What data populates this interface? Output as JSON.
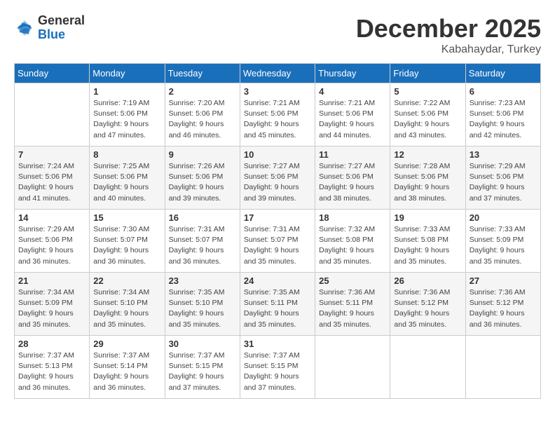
{
  "header": {
    "logo_general": "General",
    "logo_blue": "Blue",
    "month_title": "December 2025",
    "location": "Kabahaydar, Turkey"
  },
  "weekdays": [
    "Sunday",
    "Monday",
    "Tuesday",
    "Wednesday",
    "Thursday",
    "Friday",
    "Saturday"
  ],
  "weeks": [
    [
      {
        "day": "",
        "info": ""
      },
      {
        "day": "1",
        "info": "Sunrise: 7:19 AM\nSunset: 5:06 PM\nDaylight: 9 hours\nand 47 minutes."
      },
      {
        "day": "2",
        "info": "Sunrise: 7:20 AM\nSunset: 5:06 PM\nDaylight: 9 hours\nand 46 minutes."
      },
      {
        "day": "3",
        "info": "Sunrise: 7:21 AM\nSunset: 5:06 PM\nDaylight: 9 hours\nand 45 minutes."
      },
      {
        "day": "4",
        "info": "Sunrise: 7:21 AM\nSunset: 5:06 PM\nDaylight: 9 hours\nand 44 minutes."
      },
      {
        "day": "5",
        "info": "Sunrise: 7:22 AM\nSunset: 5:06 PM\nDaylight: 9 hours\nand 43 minutes."
      },
      {
        "day": "6",
        "info": "Sunrise: 7:23 AM\nSunset: 5:06 PM\nDaylight: 9 hours\nand 42 minutes."
      }
    ],
    [
      {
        "day": "7",
        "info": "Sunrise: 7:24 AM\nSunset: 5:06 PM\nDaylight: 9 hours\nand 41 minutes."
      },
      {
        "day": "8",
        "info": "Sunrise: 7:25 AM\nSunset: 5:06 PM\nDaylight: 9 hours\nand 40 minutes."
      },
      {
        "day": "9",
        "info": "Sunrise: 7:26 AM\nSunset: 5:06 PM\nDaylight: 9 hours\nand 39 minutes."
      },
      {
        "day": "10",
        "info": "Sunrise: 7:27 AM\nSunset: 5:06 PM\nDaylight: 9 hours\nand 39 minutes."
      },
      {
        "day": "11",
        "info": "Sunrise: 7:27 AM\nSunset: 5:06 PM\nDaylight: 9 hours\nand 38 minutes."
      },
      {
        "day": "12",
        "info": "Sunrise: 7:28 AM\nSunset: 5:06 PM\nDaylight: 9 hours\nand 38 minutes."
      },
      {
        "day": "13",
        "info": "Sunrise: 7:29 AM\nSunset: 5:06 PM\nDaylight: 9 hours\nand 37 minutes."
      }
    ],
    [
      {
        "day": "14",
        "info": "Sunrise: 7:29 AM\nSunset: 5:06 PM\nDaylight: 9 hours\nand 36 minutes."
      },
      {
        "day": "15",
        "info": "Sunrise: 7:30 AM\nSunset: 5:07 PM\nDaylight: 9 hours\nand 36 minutes."
      },
      {
        "day": "16",
        "info": "Sunrise: 7:31 AM\nSunset: 5:07 PM\nDaylight: 9 hours\nand 36 minutes."
      },
      {
        "day": "17",
        "info": "Sunrise: 7:31 AM\nSunset: 5:07 PM\nDaylight: 9 hours\nand 35 minutes."
      },
      {
        "day": "18",
        "info": "Sunrise: 7:32 AM\nSunset: 5:08 PM\nDaylight: 9 hours\nand 35 minutes."
      },
      {
        "day": "19",
        "info": "Sunrise: 7:33 AM\nSunset: 5:08 PM\nDaylight: 9 hours\nand 35 minutes."
      },
      {
        "day": "20",
        "info": "Sunrise: 7:33 AM\nSunset: 5:09 PM\nDaylight: 9 hours\nand 35 minutes."
      }
    ],
    [
      {
        "day": "21",
        "info": "Sunrise: 7:34 AM\nSunset: 5:09 PM\nDaylight: 9 hours\nand 35 minutes."
      },
      {
        "day": "22",
        "info": "Sunrise: 7:34 AM\nSunset: 5:10 PM\nDaylight: 9 hours\nand 35 minutes."
      },
      {
        "day": "23",
        "info": "Sunrise: 7:35 AM\nSunset: 5:10 PM\nDaylight: 9 hours\nand 35 minutes."
      },
      {
        "day": "24",
        "info": "Sunrise: 7:35 AM\nSunset: 5:11 PM\nDaylight: 9 hours\nand 35 minutes."
      },
      {
        "day": "25",
        "info": "Sunrise: 7:36 AM\nSunset: 5:11 PM\nDaylight: 9 hours\nand 35 minutes."
      },
      {
        "day": "26",
        "info": "Sunrise: 7:36 AM\nSunset: 5:12 PM\nDaylight: 9 hours\nand 35 minutes."
      },
      {
        "day": "27",
        "info": "Sunrise: 7:36 AM\nSunset: 5:12 PM\nDaylight: 9 hours\nand 36 minutes."
      }
    ],
    [
      {
        "day": "28",
        "info": "Sunrise: 7:37 AM\nSunset: 5:13 PM\nDaylight: 9 hours\nand 36 minutes."
      },
      {
        "day": "29",
        "info": "Sunrise: 7:37 AM\nSunset: 5:14 PM\nDaylight: 9 hours\nand 36 minutes."
      },
      {
        "day": "30",
        "info": "Sunrise: 7:37 AM\nSunset: 5:15 PM\nDaylight: 9 hours\nand 37 minutes."
      },
      {
        "day": "31",
        "info": "Sunrise: 7:37 AM\nSunset: 5:15 PM\nDaylight: 9 hours\nand 37 minutes."
      },
      {
        "day": "",
        "info": ""
      },
      {
        "day": "",
        "info": ""
      },
      {
        "day": "",
        "info": ""
      }
    ]
  ]
}
